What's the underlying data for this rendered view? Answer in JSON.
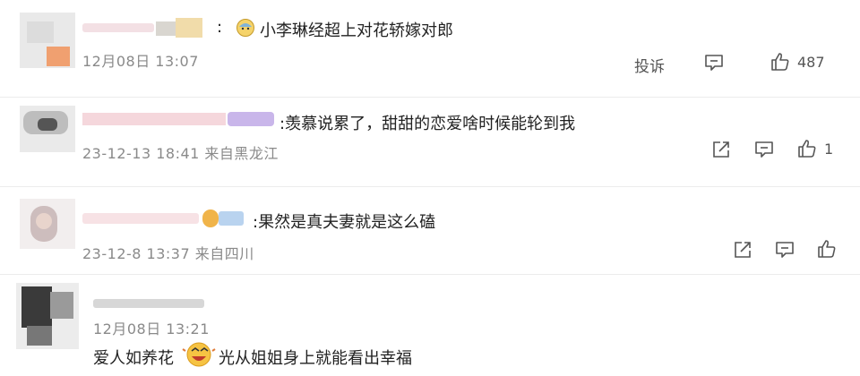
{
  "comments": [
    {
      "text": "小李琳经超上对花轿嫁对郎",
      "separator": ":",
      "meta": "12月08日 13:07",
      "report_label": "投诉",
      "like_count": "487"
    },
    {
      "text": ":羡慕说累了，甜甜的恋爱啥时候能轮到我",
      "meta": "23-12-13 18:41 来自黑龙江",
      "like_count": "1"
    },
    {
      "text": ":果然是真夫妻就是这么磕",
      "meta": "23-12-8 13:37 来自四川"
    },
    {
      "meta": "12月08日 13:21",
      "text_part1": "爱人如养花",
      "text_part2": "光从姐姐身上就能看出幸福"
    }
  ],
  "icons": {
    "report": "report-icon",
    "comment": "comment-icon",
    "like": "thumbs-up-icon",
    "share": "share-icon"
  }
}
